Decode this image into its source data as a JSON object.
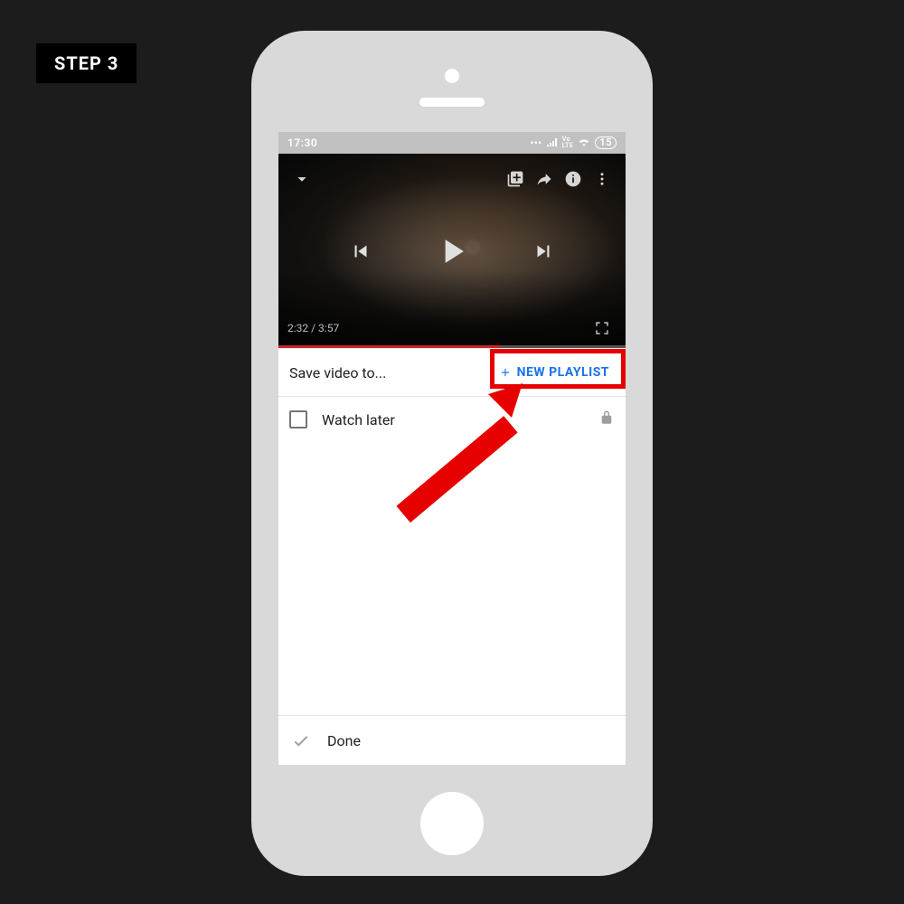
{
  "tutorial": {
    "step_label": "STEP 3"
  },
  "statusbar": {
    "time": "17:30",
    "lte": "Vo LTE",
    "battery": "15"
  },
  "video": {
    "time": "2:32 / 3:57"
  },
  "sheet": {
    "title": "Save video to...",
    "new_playlist": "NEW PLAYLIST",
    "items": [
      {
        "label": "Watch later"
      }
    ],
    "done": "Done"
  }
}
